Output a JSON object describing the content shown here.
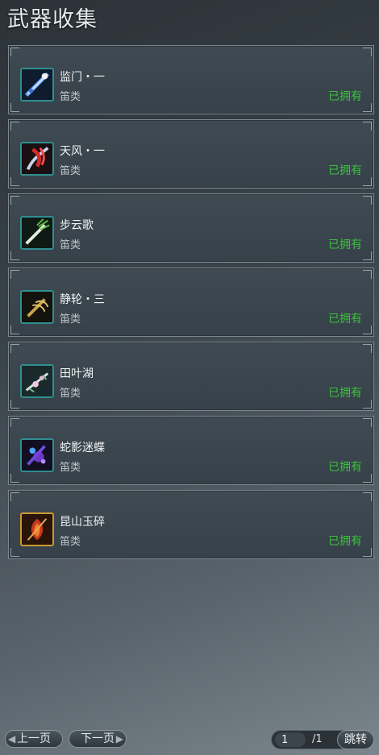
{
  "title": "武器收集",
  "items": [
    {
      "name": "监门・一",
      "type": "笛类",
      "status": "已拥有",
      "icon": "blue-flute-icon"
    },
    {
      "name": "天风・一",
      "type": "笛类",
      "status": "已拥有",
      "icon": "red-flute-icon"
    },
    {
      "name": "步云歌",
      "type": "笛类",
      "status": "已拥有",
      "icon": "green-flute-icon"
    },
    {
      "name": "静轮・三",
      "type": "笛类",
      "status": "已拥有",
      "icon": "golden-flute-icon"
    },
    {
      "name": "田叶湖",
      "type": "笛类",
      "status": "已拥有",
      "icon": "flower-flute-icon"
    },
    {
      "name": "蛇影迷蝶",
      "type": "笛类",
      "status": "已拥有",
      "icon": "purple-flute-icon"
    },
    {
      "name": "昆山玉碎",
      "type": "笛类",
      "status": "已拥有",
      "icon": "fire-flute-icon"
    }
  ],
  "pagination": {
    "prev_label": "上一页",
    "next_label": "下一页",
    "current_page": "1",
    "total": "/1",
    "jump_label": "跳转"
  },
  "colors": {
    "owned": "#3cc03c",
    "icon_border": "#2f8f8f"
  }
}
